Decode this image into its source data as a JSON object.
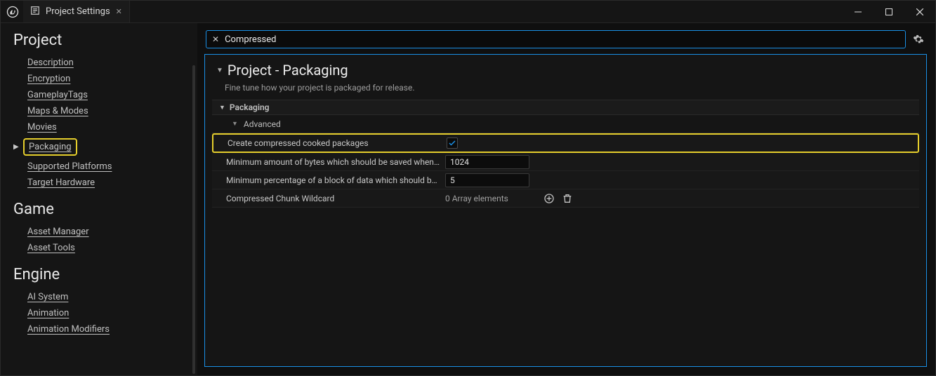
{
  "window": {
    "tab_title": "Project Settings"
  },
  "search": {
    "value": "Compressed"
  },
  "sidebar": {
    "sections": [
      {
        "title": "Project",
        "items": [
          "Description",
          "Encryption",
          "GameplayTags",
          "Maps & Modes",
          "Movies",
          "Packaging",
          "Supported Platforms",
          "Target Hardware"
        ],
        "selected": "Packaging"
      },
      {
        "title": "Game",
        "items": [
          "Asset Manager",
          "Asset Tools"
        ]
      },
      {
        "title": "Engine",
        "items": [
          "AI System",
          "Animation",
          "Animation Modifiers"
        ]
      }
    ]
  },
  "panel": {
    "title": "Project - Packaging",
    "description": "Fine tune how your project is packaged for release.",
    "category": "Packaging",
    "subcategory": "Advanced",
    "rows": {
      "compressed": {
        "label": "Create compressed cooked packages",
        "checked": true
      },
      "min_bytes": {
        "label": "Minimum amount of bytes which should be saved when com…",
        "value": "1024"
      },
      "min_pct": {
        "label": "Minimum percentage of a block of data which should be sav…",
        "value": "5"
      },
      "wildcard": {
        "label": "Compressed Chunk Wildcard",
        "value_text": "0 Array elements"
      }
    }
  }
}
